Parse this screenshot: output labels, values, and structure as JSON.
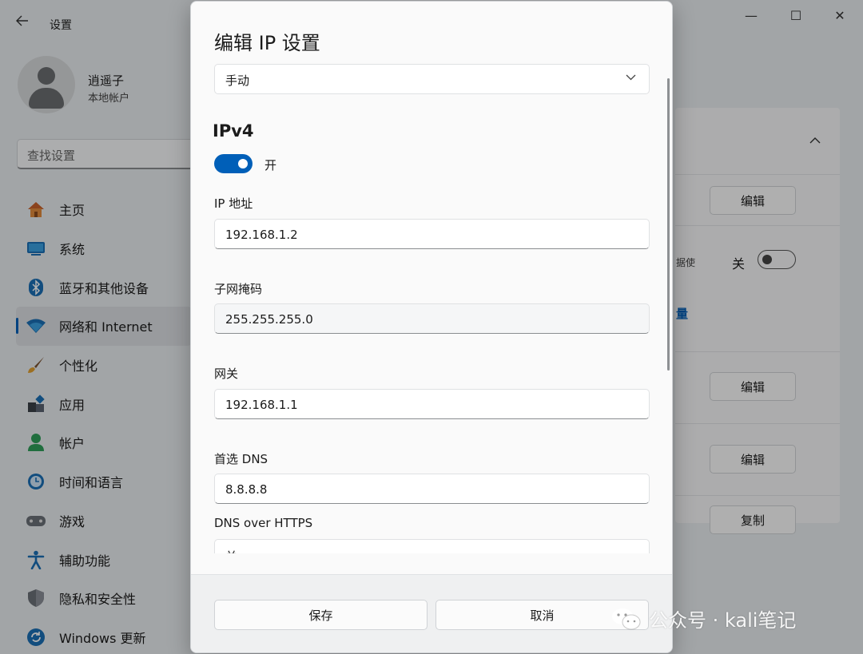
{
  "window": {
    "back_icon": "back-arrow-icon",
    "title": "设置",
    "controls": {
      "minimize": "—",
      "maximize": "☐",
      "close": "✕"
    }
  },
  "user": {
    "name": "逍遥子",
    "account_type": "本地帐户"
  },
  "search": {
    "placeholder": "查找设置"
  },
  "sidebar": {
    "items": [
      {
        "label": "主页",
        "icon": "home-icon"
      },
      {
        "label": "系统",
        "icon": "system-icon"
      },
      {
        "label": "蓝牙和其他设备",
        "icon": "bluetooth-icon"
      },
      {
        "label": "网络和 Internet",
        "icon": "wifi-icon",
        "active": true
      },
      {
        "label": "个性化",
        "icon": "brush-icon"
      },
      {
        "label": "应用",
        "icon": "apps-icon"
      },
      {
        "label": "帐户",
        "icon": "account-icon"
      },
      {
        "label": "时间和语言",
        "icon": "clock-globe-icon"
      },
      {
        "label": "游戏",
        "icon": "gamepad-icon"
      },
      {
        "label": "辅助功能",
        "icon": "accessibility-icon"
      },
      {
        "label": "隐私和安全性",
        "icon": "shield-icon"
      },
      {
        "label": "Windows 更新",
        "icon": "update-icon"
      }
    ]
  },
  "background_panel": {
    "edit_1": "编辑",
    "partial_text": "据使",
    "off_label": "关",
    "partial_link": "量",
    "edit_2": "编辑",
    "edit_3": "编辑",
    "copy": "复制"
  },
  "dialog": {
    "title": "编辑 IP 设置",
    "mode_select": "手动",
    "section": "IPv4",
    "toggle_label": "开",
    "toggle_on": true,
    "fields": {
      "ip_label": "IP 地址",
      "ip_value": "192.168.1.2",
      "subnet_label": "子网掩码",
      "subnet_value": "255.255.255.0",
      "gateway_label": "网关",
      "gateway_value": "192.168.1.1",
      "dns_label": "首选 DNS",
      "dns_value": "8.8.8.8",
      "doh_label": "DNS over HTTPS",
      "doh_value": "关"
    },
    "save": "保存",
    "cancel": "取消"
  },
  "watermark": {
    "text": "公众号 · kali笔记"
  },
  "colors": {
    "accent": "#005fb8",
    "dialog_bg": "#fafafa",
    "footer_bg": "#eff0f1"
  }
}
